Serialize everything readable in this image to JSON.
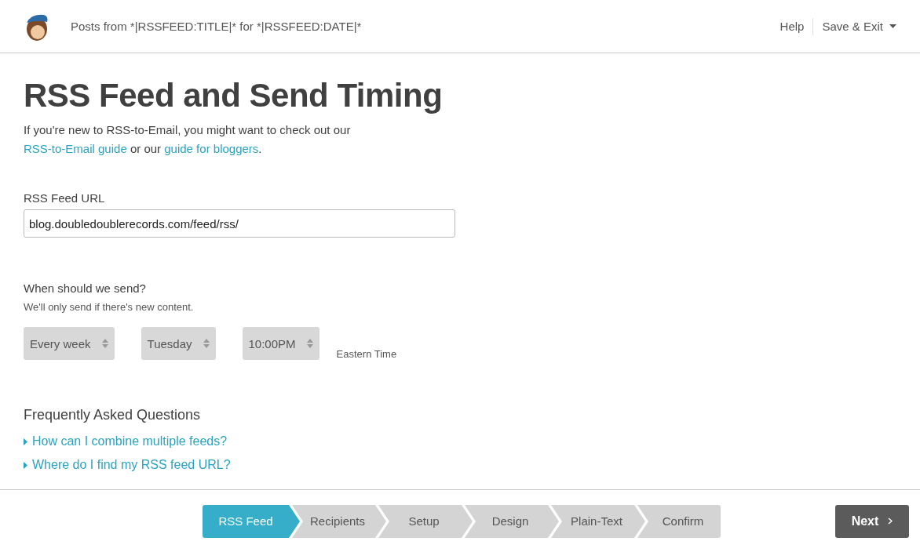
{
  "header": {
    "title": "Posts from *|RSSFEED:TITLE|* for *|RSSFEED:DATE|*",
    "help": "Help",
    "save_exit": "Save & Exit"
  },
  "page": {
    "heading": "RSS Feed and Send Timing",
    "intro": [
      {
        "kind": "text",
        "text": "If you're new to RSS-to-Email, you might want to check out our "
      },
      {
        "kind": "link",
        "text": "RSS-to-Email guide"
      },
      {
        "kind": "text",
        "text": " or our "
      },
      {
        "kind": "link",
        "text": "guide for bloggers"
      },
      {
        "kind": "text",
        "text": "."
      }
    ],
    "feed_url": {
      "label": "RSS Feed URL",
      "value": "blog.doubledoublerecords.com/feed/rss/"
    },
    "send": {
      "label": "When should we send?",
      "hint": "We'll only send if there's new content.",
      "selects": [
        "Every week",
        "Tuesday",
        "10:00PM"
      ],
      "timezone": "Eastern Time"
    },
    "faq": {
      "heading": "Frequently Asked Questions",
      "items": [
        "How can I combine multiple feeds?",
        "Where do I find my RSS feed URL?"
      ]
    }
  },
  "steps": [
    {
      "label": "RSS Feed",
      "selected": true
    },
    {
      "label": "Recipients",
      "selected": false
    },
    {
      "label": "Setup",
      "selected": false
    },
    {
      "label": "Design",
      "selected": false
    },
    {
      "label": "Plain-Text",
      "selected": false
    },
    {
      "label": "Confirm",
      "selected": false
    }
  ],
  "next": "Next"
}
